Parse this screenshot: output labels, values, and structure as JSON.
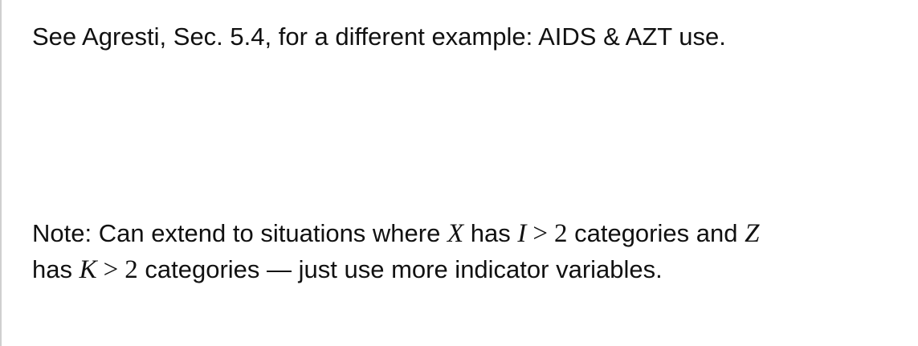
{
  "slide": {
    "line1": "See Agresti, Sec. 5.4, for a different example: AIDS & AZT use.",
    "note": {
      "part1": "Note: Can extend to situations where ",
      "var_x": "X",
      "part2": " has ",
      "var_i": "I",
      "gt1": ">",
      "num1": "2",
      "part3": " categories and ",
      "var_z": "Z",
      "part4": "has ",
      "var_k": "K",
      "gt2": ">",
      "num2": "2",
      "part5": " categories — just use more indicator variables."
    }
  }
}
